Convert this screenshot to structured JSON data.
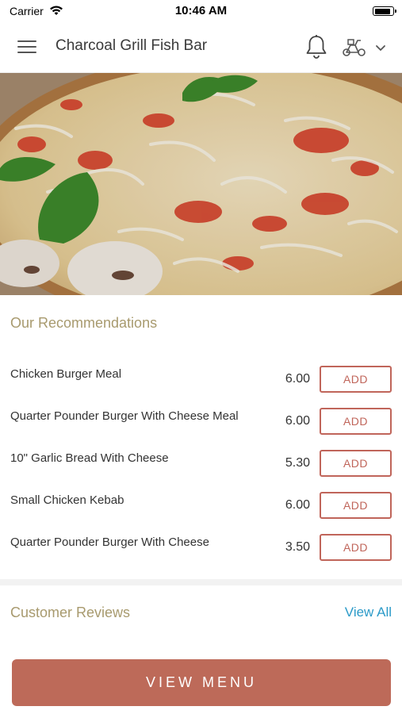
{
  "status_bar": {
    "carrier": "Carrier",
    "time": "10:46 AM",
    "battery_level": 0.9
  },
  "header": {
    "title": "Charcoal Grill Fish Bar",
    "icons": [
      "menu-icon",
      "bell-icon",
      "delivery-scooter-icon",
      "chevron-down-icon"
    ]
  },
  "hero": {
    "image": "pizza-banner-image"
  },
  "recommendations": {
    "title": "Our Recommendations",
    "items": [
      {
        "name": "Chicken Burger Meal",
        "price": "6.00",
        "button": "ADD"
      },
      {
        "name": "Quarter Pounder Burger With Cheese Meal",
        "price": "6.00",
        "button": "ADD"
      },
      {
        "name": "10\" Garlic Bread With Cheese",
        "price": "5.30",
        "button": "ADD"
      },
      {
        "name": "Small Chicken Kebab",
        "price": "6.00",
        "button": "ADD"
      },
      {
        "name": "Quarter Pounder Burger With Cheese",
        "price": "3.50",
        "button": "ADD"
      }
    ]
  },
  "reviews": {
    "title": "Customer Reviews",
    "view_all": "View All"
  },
  "footer": {
    "view_menu": "VIEW MENU"
  },
  "colors": {
    "accent": "#bd6a59",
    "section_title": "#a89a6e",
    "link": "#2b9ac8"
  }
}
